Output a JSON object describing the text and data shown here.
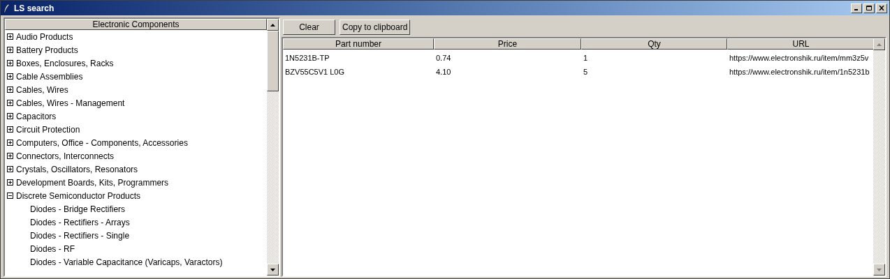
{
  "window": {
    "title": "LS search"
  },
  "tree": {
    "header": "Electronic Components",
    "items": [
      {
        "label": "Audio Products",
        "expanded": false
      },
      {
        "label": "Battery Products",
        "expanded": false
      },
      {
        "label": "Boxes, Enclosures, Racks",
        "expanded": false
      },
      {
        "label": "Cable Assemblies",
        "expanded": false
      },
      {
        "label": "Cables, Wires",
        "expanded": false
      },
      {
        "label": "Cables, Wires - Management",
        "expanded": false
      },
      {
        "label": "Capacitors",
        "expanded": false
      },
      {
        "label": "Circuit Protection",
        "expanded": false
      },
      {
        "label": "Computers, Office - Components, Accessories",
        "expanded": false
      },
      {
        "label": "Connectors, Interconnects",
        "expanded": false
      },
      {
        "label": "Crystals, Oscillators, Resonators",
        "expanded": false
      },
      {
        "label": "Development Boards, Kits, Programmers",
        "expanded": false
      },
      {
        "label": "Discrete Semiconductor Products",
        "expanded": true,
        "children": [
          {
            "label": "Diodes - Bridge Rectifiers"
          },
          {
            "label": "Diodes - Rectifiers - Arrays"
          },
          {
            "label": "Diodes - Rectifiers - Single"
          },
          {
            "label": "Diodes - RF"
          },
          {
            "label": "Diodes - Variable Capacitance (Varicaps, Varactors)"
          }
        ]
      }
    ]
  },
  "buttons": [
    "Clear",
    "Copy to clipboard"
  ],
  "table": {
    "columns": [
      "Part number",
      "Price",
      "Qty",
      "URL"
    ],
    "rows": [
      [
        "1N5231B-TP",
        "0.74",
        "1",
        "https://www.electronshik.ru/item/mm3z5v"
      ],
      [
        "BZV55C5V1 L0G",
        "4.10",
        "5",
        "https://www.electronshik.ru/item/1n5231b"
      ]
    ]
  }
}
